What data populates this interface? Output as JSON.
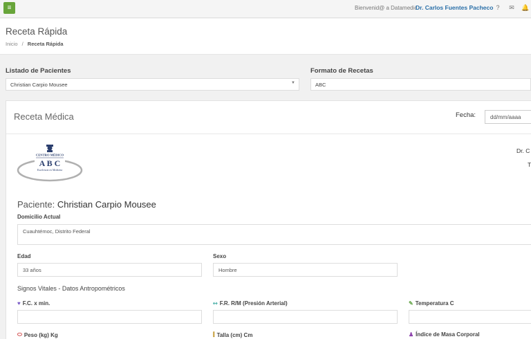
{
  "topbar": {
    "menu_icon": "hamburger-icon",
    "welcome": "Bienvenid@ a Datamedic",
    "doctor": "Dr. Carlos Fuentes Pacheco",
    "icons": [
      "help-icon",
      "mail-icon",
      "bell-icon"
    ]
  },
  "header": {
    "title": "Receta Rápida",
    "breadcrumb_home": "Inicio",
    "breadcrumb_sep": "/",
    "breadcrumb_current": "Receta Rápida"
  },
  "selectors": {
    "patients_label": "Listado de Pacientes",
    "patients_value": "Christian Carpio Mousee",
    "format_label": "Formato de Recetas",
    "format_value": "ABC"
  },
  "card": {
    "title": "Receta Médica",
    "fecha_label": "Fecha:",
    "fecha_placeholder": "dd/mm/aaaa",
    "doctor_short": "Dr. C",
    "right_t": "T",
    "logo": {
      "top": "CENTRO MÉDICO",
      "main": "A B C",
      "sub": "Excelencia en Medicina"
    },
    "patient_prefix": "Paciente:",
    "patient_name": "Christian Carpio Mousee",
    "domicilio_label": "Domicilio Actual",
    "domicilio_value": "Cuauhtémoc, Distrito Federal",
    "edad_label": "Edad",
    "edad_value": "33 años",
    "sexo_label": "Sexo",
    "sexo_value": "Hombre",
    "signos_title": "Signos Vitales - Datos Antropométricos",
    "vitals": [
      {
        "label": "F.C. x min.",
        "icon": "heart-icon",
        "color": "#7a5cc7"
      },
      {
        "label": "F.R. R/M (Presión Arterial)",
        "icon": "lungs-icon",
        "color": "#2aa198"
      },
      {
        "label": "Temperatura C",
        "icon": "thermometer-icon",
        "color": "#6aa84f"
      },
      {
        "label": "Peso (kg) Kg",
        "icon": "scale-icon",
        "color": "#cc3333"
      },
      {
        "label": "Talla (cm) Cm",
        "icon": "ruler-icon",
        "color": "#b8860b"
      },
      {
        "label": "Índice de Masa Corporal",
        "icon": "body-icon",
        "color": "#8e44ad"
      }
    ]
  }
}
